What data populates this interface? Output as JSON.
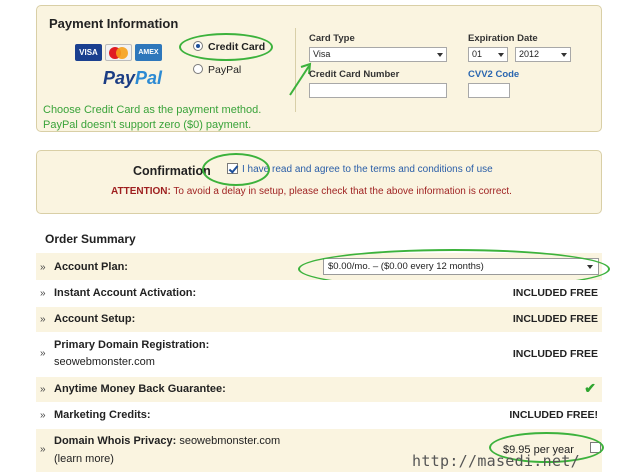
{
  "payment": {
    "title": "Payment Information",
    "logos": {
      "visa": "VISA",
      "mastercard": "MasterCard",
      "amex": "AMEX",
      "paypal_1": "Pay",
      "paypal_2": "Pal"
    },
    "options": [
      {
        "label": "Credit Card",
        "selected": true
      },
      {
        "label": "PayPal",
        "selected": false
      }
    ],
    "hint_line1": "Choose Credit Card as the payment method.",
    "hint_line2": "PayPal doesn't support zero ($0) payment.",
    "card_type_label": "Card Type",
    "card_type_value": "Visa",
    "card_number_label": "Credit Card Number",
    "card_number_value": "",
    "expiration_label": "Expiration Date",
    "exp_month": "01",
    "exp_year": "2012",
    "cvv_label": "CVV2 Code",
    "cvv_value": ""
  },
  "confirmation": {
    "title": "Confirmation",
    "agree_checked": true,
    "agree_text": "I have read and agree to the terms and conditions of use",
    "attention_label": "ATTENTION:",
    "attention_text": " To avoid a delay in setup, please check that the above information is correct."
  },
  "order_summary": {
    "title": "Order Summary",
    "bullet": "»",
    "rows": [
      {
        "title": "Account Plan:",
        "select_value": "$0.00/mo. – ($0.00 every 12 months)"
      },
      {
        "title": "Instant Account Activation:",
        "value": "INCLUDED FREE"
      },
      {
        "title": "Account Setup:",
        "value": "INCLUDED FREE"
      },
      {
        "title": "Primary Domain Registration:",
        "sub": "seowebmonster.com",
        "value": "INCLUDED FREE"
      },
      {
        "title": "Anytime Money Back Guarantee:",
        "check": "✔"
      },
      {
        "title": "Marketing Credits:",
        "value": "INCLUDED FREE!"
      },
      {
        "title": "Domain Whois Privacy:",
        "title_domain": " seowebmonster.com",
        "sub": "(learn more)",
        "price": "$9.95 per year",
        "price_checked": false
      }
    ]
  },
  "watermark": "http://masedi.net/",
  "colors": {
    "panel_bg": "#faf4e0",
    "highlight": "#3cb23c",
    "attention": "#9e1f1f",
    "link": "#2a66b0"
  }
}
